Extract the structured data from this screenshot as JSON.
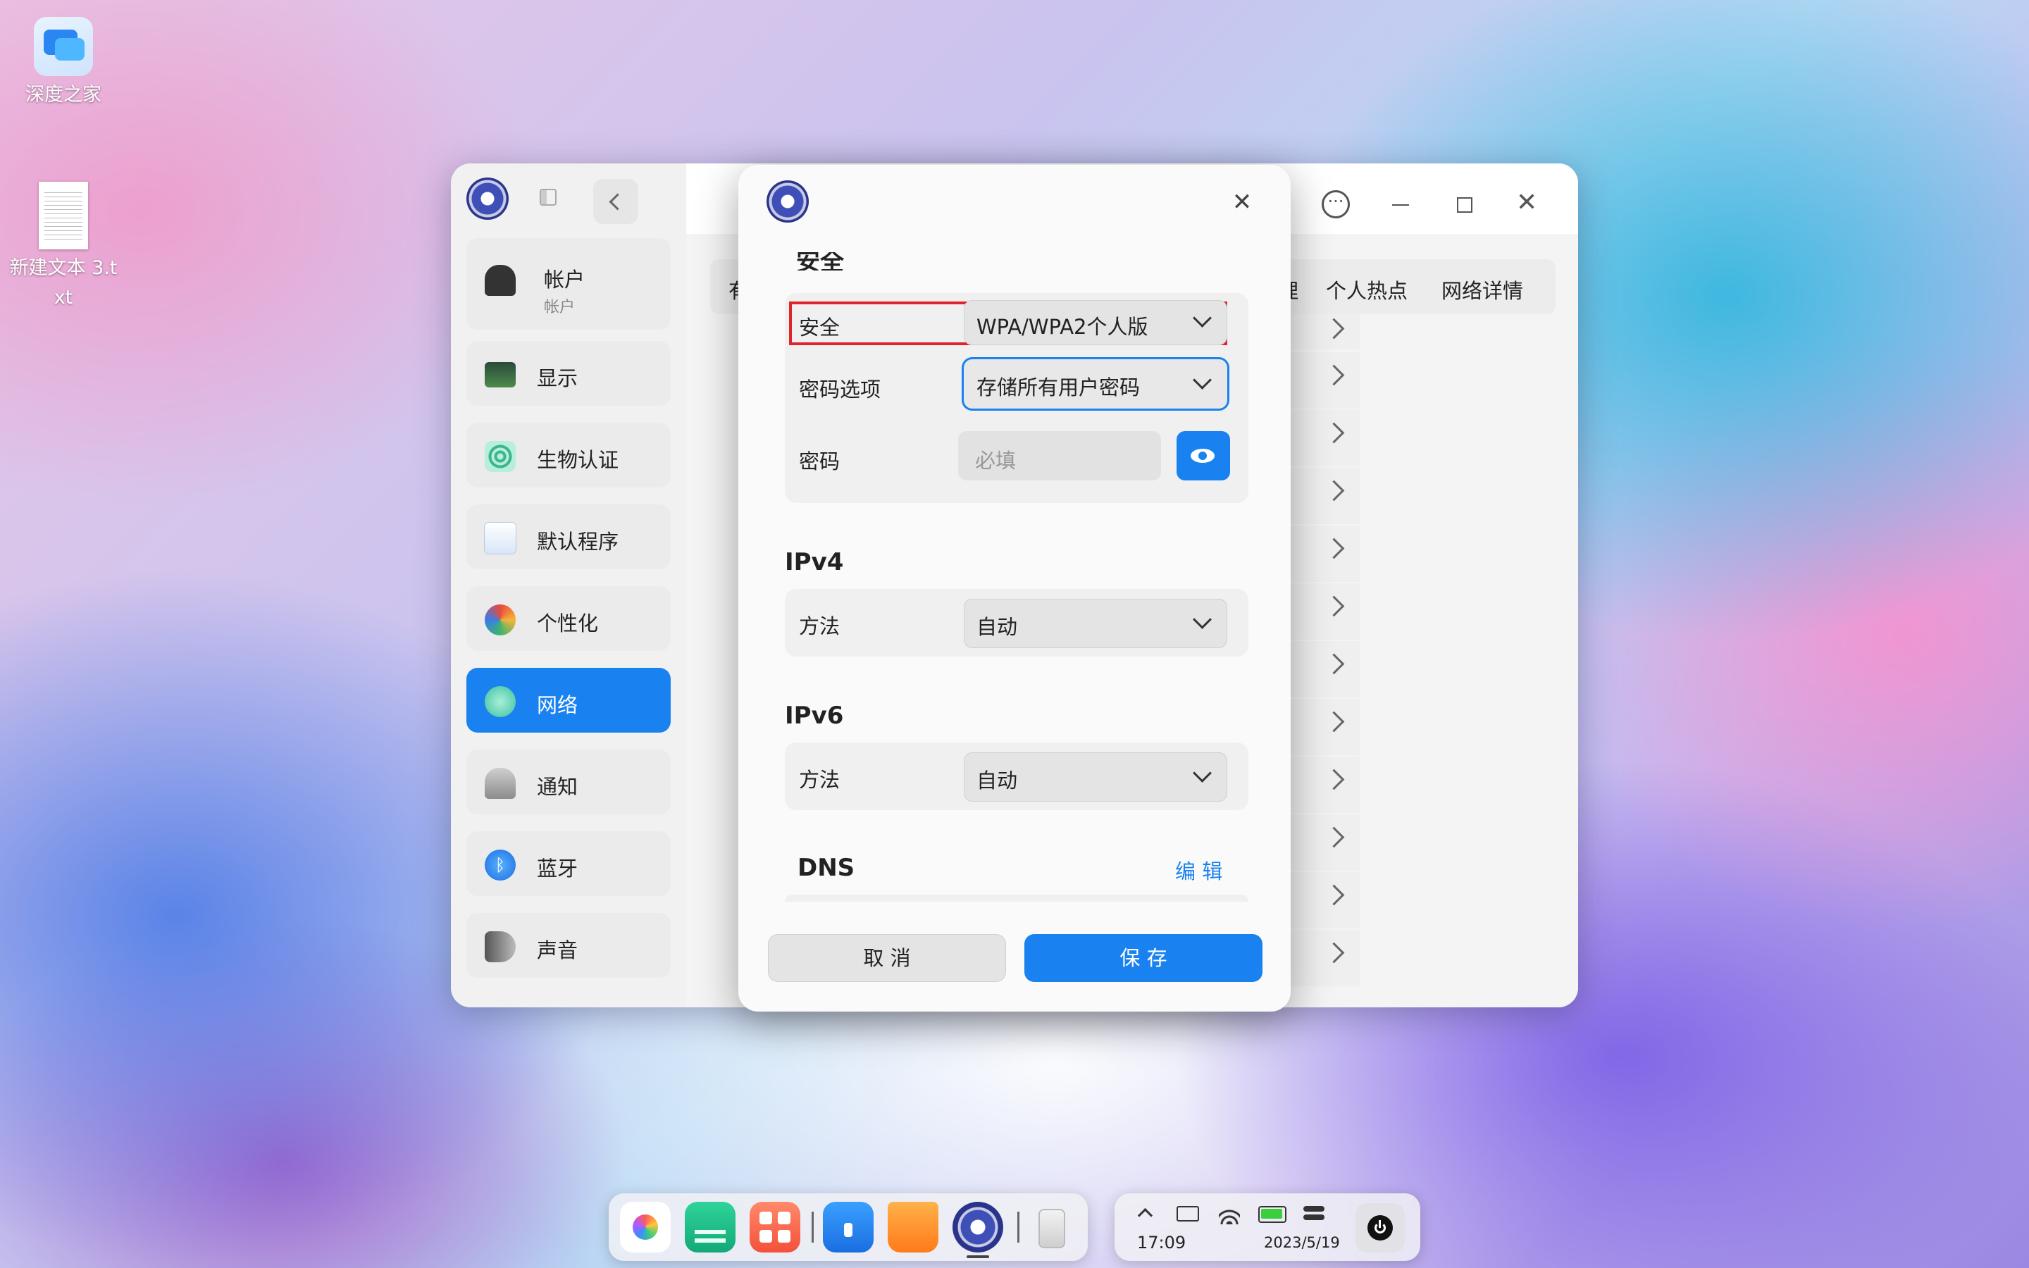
{
  "desktop": {
    "icons": [
      {
        "label": "深度之家"
      },
      {
        "label": "新建文本 3.txt"
      }
    ]
  },
  "main_window": {
    "sidebar": {
      "items": [
        {
          "label": "帐户",
          "sublabel": "帐户"
        },
        {
          "label": "显示"
        },
        {
          "label": "生物认证"
        },
        {
          "label": "默认程序"
        },
        {
          "label": "个性化"
        },
        {
          "label": "网络",
          "active": true
        },
        {
          "label": "通知"
        },
        {
          "label": "蓝牙"
        },
        {
          "label": "声音"
        }
      ]
    },
    "tabs": {
      "partial": "有",
      "manage_partial": "理",
      "hotspot": "个人热点",
      "details": "网络详情"
    }
  },
  "dialog": {
    "security_section_title": "安全",
    "security": {
      "label": "安全",
      "value": "WPA/WPA2个人版"
    },
    "password_option": {
      "label": "密码选项",
      "value": "存储所有用户密码"
    },
    "password": {
      "label": "密码",
      "placeholder": "必填"
    },
    "ipv4": {
      "title": "IPv4",
      "method_label": "方法",
      "method_value": "自动"
    },
    "ipv6": {
      "title": "IPv6",
      "method_label": "方法",
      "method_value": "自动"
    },
    "dns": {
      "title": "DNS",
      "edit_label": "编 辑"
    },
    "cancel_label": "取 消",
    "save_label": "保 存"
  },
  "tray": {
    "time": "17:09",
    "date": "2023/5/19"
  },
  "colors": {
    "accent": "#1a82f0",
    "highlight_border": "#e0242c"
  }
}
